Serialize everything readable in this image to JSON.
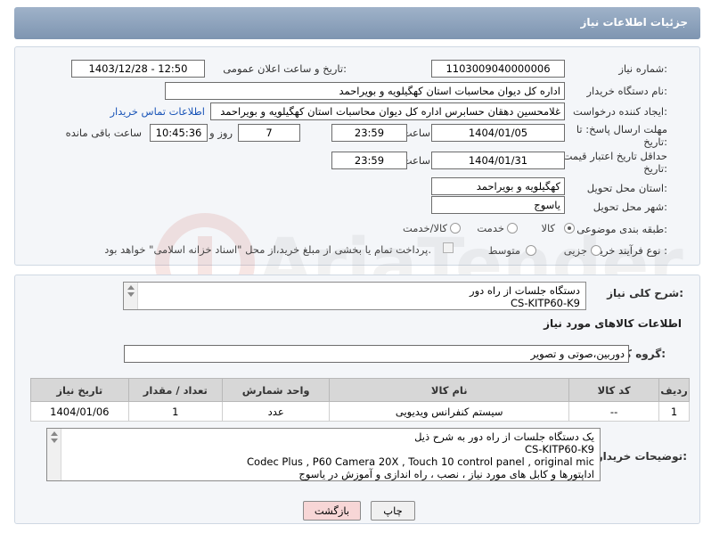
{
  "header": {
    "title": "جزئیات اطلاعات نیاز"
  },
  "fields": {
    "need_number_label": "شماره نیاز:",
    "need_number": "1103009040000006",
    "announce_label": "تاریخ و ساعت اعلان عمومی:",
    "announce_value": "1403/12/28 - 12:50",
    "buyer_org_label": "نام دستگاه خریدار:",
    "buyer_org": "اداره کل دیوان محاسبات استان کهگیلویه و بویراحمد",
    "requester_label": "ایجاد کننده درخواست:",
    "requester": "غلامحسین دهقان حسابرس اداره کل دیوان محاسبات استان کهگیلویه و بویراحمد",
    "contact_link": "اطلاعات تماس خریدار",
    "deadline_label_1": "مهلت ارسال پاسخ: تا",
    "deadline_label_2": "تاریخ:",
    "deadline_date": "1404/01/05",
    "time_label": "ساعت",
    "deadline_time": "23:59",
    "days_value": "7",
    "days_label": "روز و",
    "remaining_time": "10:45:36",
    "remaining_label": "ساعت باقی مانده",
    "validity_label_1": "حداقل تاریخ اعتبار قیمت: تا",
    "validity_label_2": "تاریخ:",
    "validity_date": "1404/01/31",
    "validity_time": "23:59",
    "province_label": "استان محل تحویل:",
    "province": "کهگیلویه و بویراحمد",
    "city_label": "شهر محل تحویل:",
    "city": "یاسوج",
    "category_label": "طبقه بندی موضوعی:",
    "category_options": [
      "کالا",
      "خدمت",
      "کالا/خدمت"
    ],
    "process_label": "نوع فرآیند خرید :",
    "process_options": [
      "جزیی",
      "متوسط"
    ],
    "payment_note": "پرداخت تمام یا بخشی از مبلغ خرید،از محل \"اسناد خزانه اسلامی\" خواهد بود."
  },
  "description": {
    "label": "شرح کلی نیاز:",
    "lines": [
      "دستگاه جلسات از راه دور",
      "CS-KITP60-K9"
    ]
  },
  "goods_info_title": "اطلاعات کالاهای مورد نیاز",
  "goods_group": {
    "label": "گروه کالا:",
    "value": "دوربین،صوتی و تصویر"
  },
  "table": {
    "headers": [
      "ردیف",
      "کد کالا",
      "نام کالا",
      "واحد شمارش",
      "تعداد / مقدار",
      "تاریخ نیاز"
    ],
    "rows": [
      [
        "1",
        "--",
        "سیستم کنفرانس ویدیویی",
        "عدد",
        "1",
        "1404/01/06"
      ]
    ]
  },
  "buyer_notes": {
    "label": "توضیحات خریدار:",
    "lines": [
      "یک دستگاه جلسات از راه دور به شرح ذیل",
      "CS-KITP60-K9",
      "Codec Plus ,  P60 Camera 20X , Touch 10 control panel , original mic",
      "اداپتورها و کابل های مورد نیاز ، نصب ، راه اندازی و آموزش در یاسوج"
    ]
  },
  "buttons": {
    "print": "چاپ",
    "back": "بازگشت"
  },
  "watermark_text": "AriaTender.neT",
  "colors": {
    "header": "#8aa0bb",
    "link": "#1a55b8",
    "back_button": "#f7d6d6"
  }
}
